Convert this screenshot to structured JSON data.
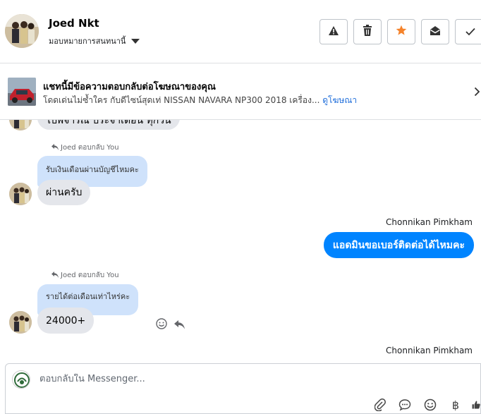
{
  "header": {
    "contact_name": "Joed Nkt",
    "assign_label": "มอบหมายการสนทนานี้",
    "buttons": [
      "warning-icon",
      "trash-icon",
      "star-icon",
      "mark-unread-icon",
      "check-icon"
    ],
    "star_color": "#f5832b"
  },
  "ad": {
    "title": "แชทนี้มีข้อความตอบกลับต่อโฆษณาของคุณ",
    "subtitle": "โดดเด่นไม่ซ้ำใคร กับดีไซน์สุดเท่ NISSAN NAVARA NP300 2018 เครื่อง...",
    "link": "ดูโฆษณา"
  },
  "messages": {
    "partial_top": "ไปพิจารณ ประจำเดือน ทุกวัน",
    "reply1_hint": "Joed ตอบกลับ You",
    "reply1_quote": "รับเงินเดือนผ่านบัญชีไหมคะ",
    "reply1_text": "ผ่านครับ",
    "out1_sender": "Chonnikan Pimkham",
    "out1_text": "แอดมินขอเบอร์ติดต่อได้ไหมคะ",
    "reply2_hint": "Joed ตอบกลับ You",
    "reply2_quote": "รายได้ต่อเดือนเท่าไหร่คะ",
    "reply2_text": "24000+",
    "out2_sender": "Chonnikan Pimkham",
    "out_color": "#0084ff"
  },
  "composer": {
    "placeholder": "ตอบกลับใน Messenger...",
    "icons": [
      "attachment-icon",
      "saved-reply-icon",
      "emoji-icon",
      "baht-icon",
      "like-icon"
    ],
    "baht_symbol": "฿"
  }
}
